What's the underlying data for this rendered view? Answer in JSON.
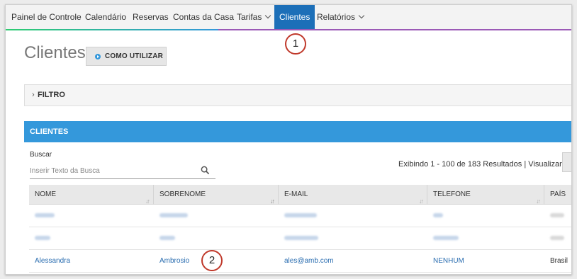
{
  "nav": {
    "items": [
      {
        "label": "Painel de Controle",
        "dropdown": false
      },
      {
        "label": "Calendário",
        "dropdown": false
      },
      {
        "label": "Reservas",
        "dropdown": false
      },
      {
        "label": "Contas da Casa",
        "dropdown": false
      },
      {
        "label": "Tarifas",
        "dropdown": true
      },
      {
        "label": "Clientes",
        "dropdown": false,
        "active": true
      },
      {
        "label": "Relatórios",
        "dropdown": true
      }
    ]
  },
  "page": {
    "title": "Clientes",
    "howto_label": "COMO UTILIZAR"
  },
  "callouts": {
    "one": "1",
    "two": "2"
  },
  "filter": {
    "label": "FILTRO"
  },
  "clients": {
    "header": "CLIENTES"
  },
  "search": {
    "label": "Buscar",
    "placeholder": "Inserir Texto da Busca"
  },
  "results": {
    "text": "Exibindo 1 - 100 de 183 Resultados",
    "separator": "|",
    "view_label": "Visualizar"
  },
  "table": {
    "columns": [
      "NOME",
      "SOBRENOME",
      "E-MAIL",
      "TELEFONE",
      "PAÍS"
    ],
    "visible_row": {
      "nome": "Alessandra",
      "sobrenome": "Ambrosio",
      "email": "ales@amb.com",
      "telefone": "NENHUM",
      "pais": "Brasil"
    }
  },
  "colors": {
    "accent": "#3498db",
    "nav_active": "#1c6fb8",
    "link": "#2a6db0",
    "callout": "#c0392b"
  }
}
